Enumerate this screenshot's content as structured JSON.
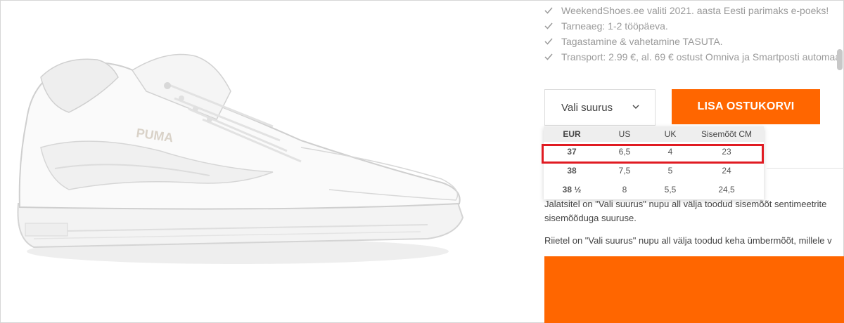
{
  "usp": {
    "items": [
      "WeekendShoes.ee valiti 2021. aasta Eesti parimaks e-poeks!",
      "Tarneaeg: 1-2 tööpäeva.",
      "Tagastamine & vahetamine TASUTA.",
      "Transport: 2.99 €, al. 69 € ostust Omniva ja Smartposti automaa"
    ]
  },
  "size_select": {
    "label": "Vali suurus"
  },
  "cart": {
    "label": "LISA OSTUKORVI"
  },
  "size_table": {
    "headers": [
      "EUR",
      "US",
      "UK",
      "Sisemõõt CM"
    ],
    "rows": [
      [
        "37",
        "6,5",
        "4",
        "23"
      ],
      [
        "38",
        "7,5",
        "5",
        "24"
      ],
      [
        "38 ½",
        "8",
        "5,5",
        "24,5"
      ]
    ]
  },
  "description": {
    "line1": "Jalatsitel on \"Vali suurus\" nupu all välja toodud sisemõõt sentimeetrite",
    "line2": "sisemõõduga suuruse.",
    "line3": "Riietel on \"Vali suurus\" nupu all välja toodud keha ümbermõõt, millele v"
  },
  "product_image": {
    "brand_text": "PUMA"
  },
  "colors": {
    "accent": "#ff6600",
    "highlight": "#e01b22"
  }
}
